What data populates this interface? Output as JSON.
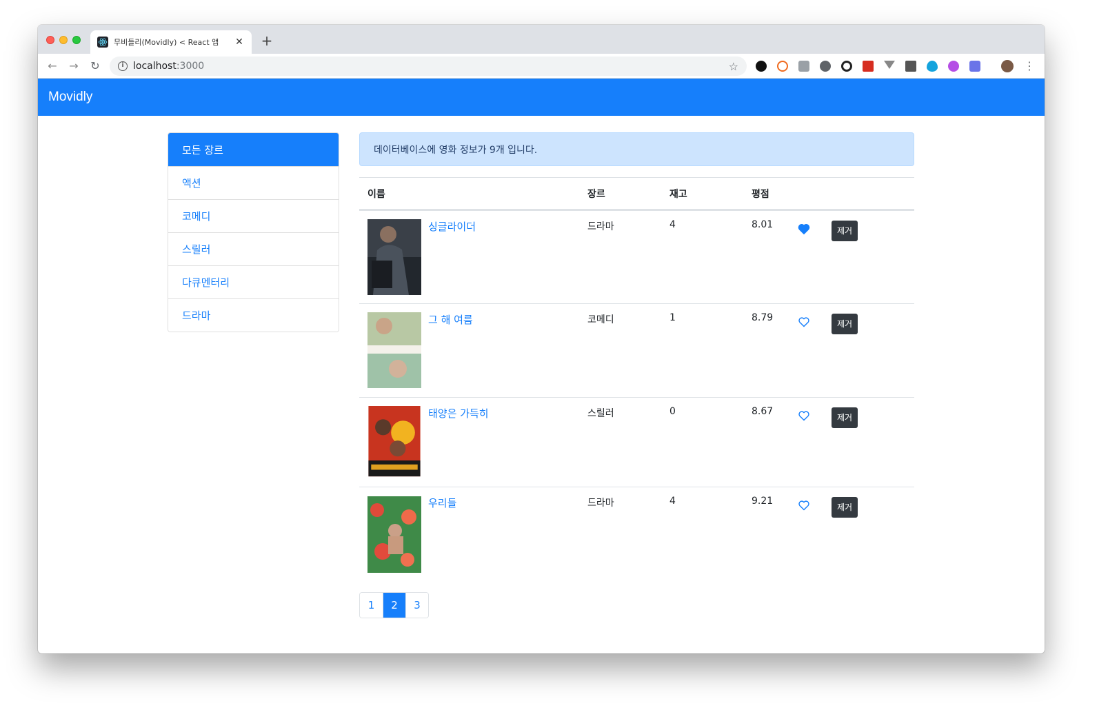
{
  "browser": {
    "tab_title": "무비들리(Movidly) < React 앱",
    "url_host": "localhost",
    "url_port": ":3000"
  },
  "app": {
    "brand": "Movidly",
    "accent": "#167ffb"
  },
  "sidebar": {
    "items": [
      {
        "label": "모든 장르",
        "active": true
      },
      {
        "label": "액션",
        "active": false
      },
      {
        "label": "코메디",
        "active": false
      },
      {
        "label": "스릴러",
        "active": false
      },
      {
        "label": "다큐멘터리",
        "active": false
      },
      {
        "label": "드라마",
        "active": false
      }
    ]
  },
  "main": {
    "alert": "데이터베이스에 영화 정보가 9개 입니다.",
    "table": {
      "headers": [
        "이름",
        "장르",
        "재고",
        "평점"
      ],
      "rows": [
        {
          "title": "싱글라이더",
          "genre": "드라마",
          "stock": "4",
          "rating": "8.01",
          "liked": true,
          "remove": "제거"
        },
        {
          "title": "그 해 여름",
          "genre": "코메디",
          "stock": "1",
          "rating": "8.79",
          "liked": false,
          "remove": "제거"
        },
        {
          "title": "태양은 가득히",
          "genre": "스릴러",
          "stock": "0",
          "rating": "8.67",
          "liked": false,
          "remove": "제거"
        },
        {
          "title": "우리들",
          "genre": "드라마",
          "stock": "4",
          "rating": "9.21",
          "liked": false,
          "remove": "제거"
        }
      ]
    },
    "pagination": {
      "pages": [
        "1",
        "2",
        "3"
      ],
      "current": "2"
    }
  }
}
